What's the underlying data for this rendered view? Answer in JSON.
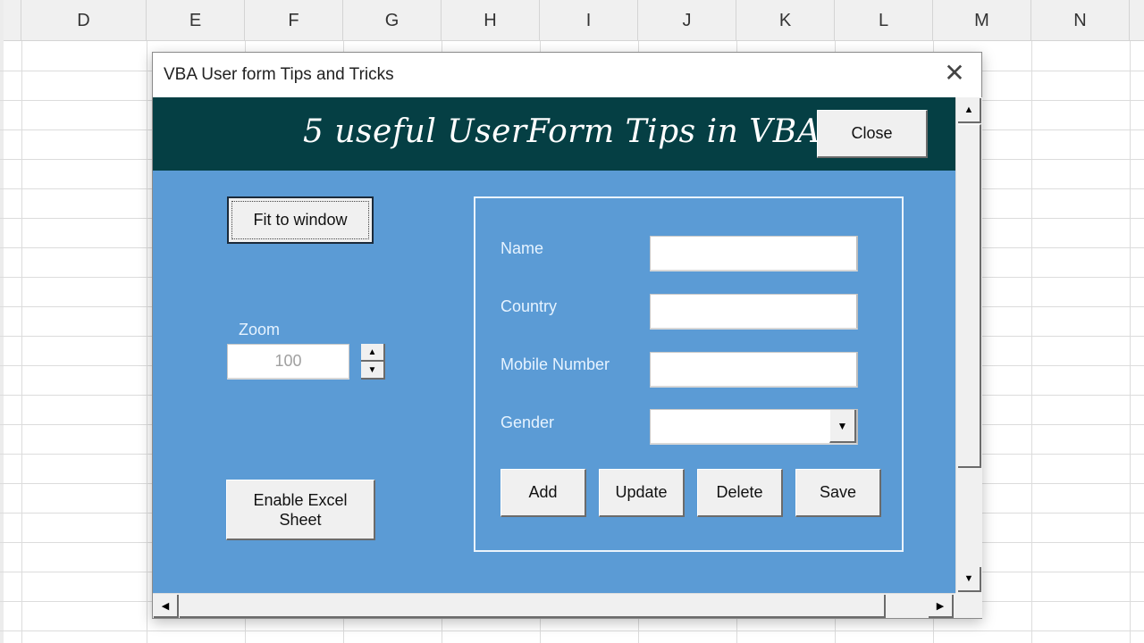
{
  "sheet": {
    "columns": [
      "D",
      "E",
      "F",
      "G",
      "H",
      "I",
      "J",
      "K",
      "L",
      "M",
      "N"
    ]
  },
  "dialog": {
    "title": "VBA User form Tips and Tricks",
    "close_glyph": "✕",
    "banner_title": "5 useful UserForm Tips in VBA",
    "close_button": "Close",
    "fit_button": "Fit to window",
    "zoom": {
      "label": "Zoom",
      "value": "100",
      "up_glyph": "▲",
      "down_glyph": "▼"
    },
    "enable_button": "Enable Excel\nSheet",
    "form": {
      "fields": [
        {
          "label": "Name",
          "value": ""
        },
        {
          "label": "Country",
          "value": ""
        },
        {
          "label": "Mobile Number",
          "value": ""
        },
        {
          "label": "Gender",
          "value": "",
          "type": "combo"
        }
      ],
      "combo_glyph": "▼",
      "actions": [
        "Add",
        "Update",
        "Delete",
        "Save"
      ]
    },
    "scroll": {
      "up": "▲",
      "down": "▼",
      "left": "◀",
      "right": "▶"
    },
    "colors": {
      "banner": "#053f44",
      "client": "#5b9bd5"
    }
  }
}
